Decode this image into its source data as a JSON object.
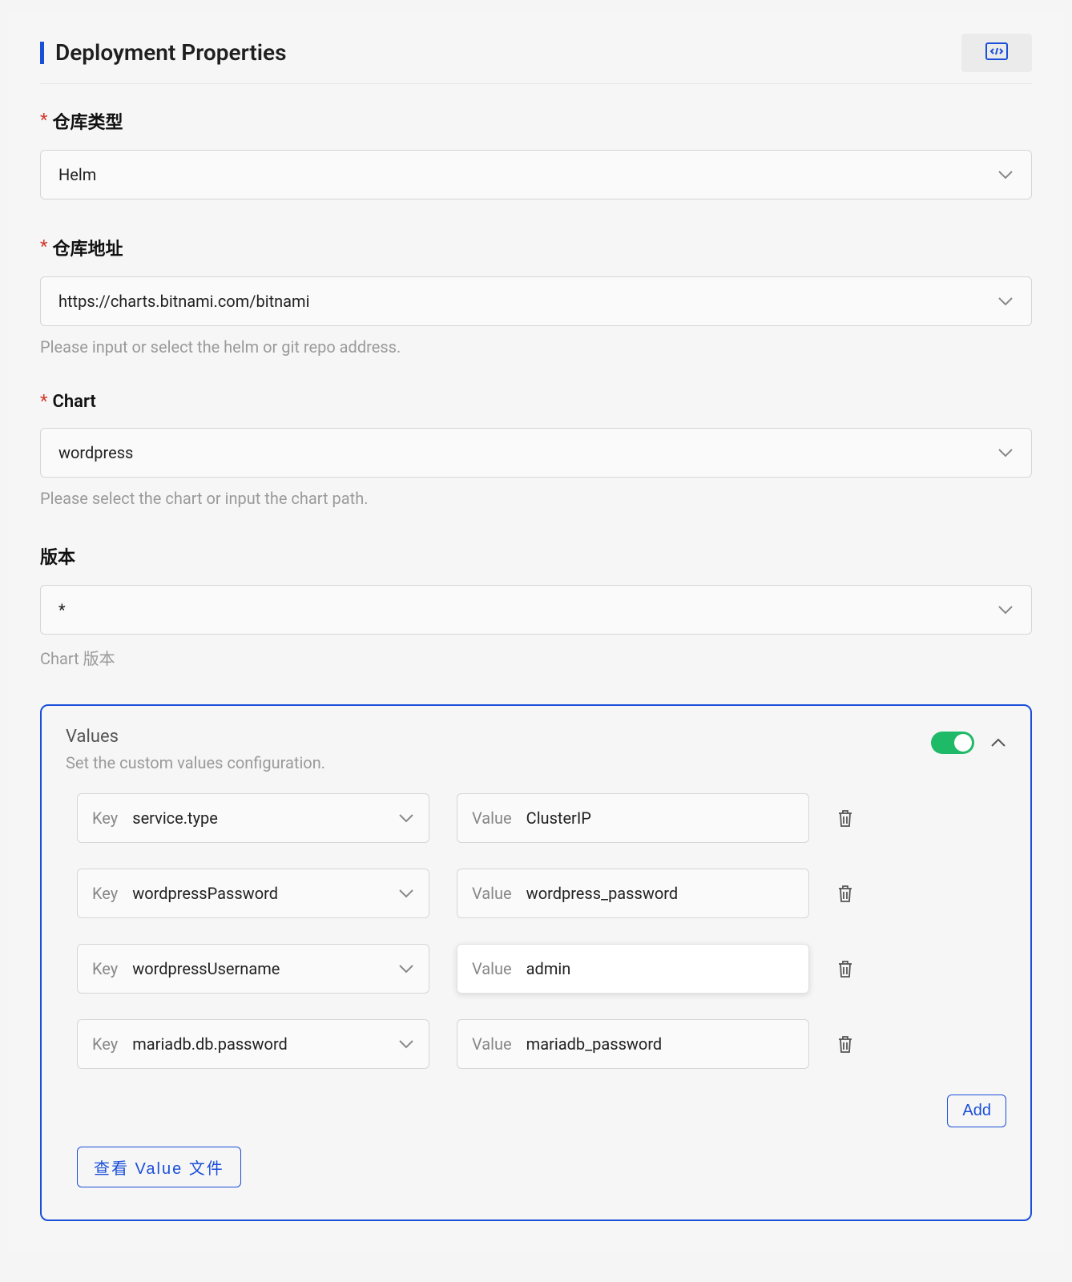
{
  "header": {
    "title": "Deployment Properties"
  },
  "fields": {
    "repo_type": {
      "label": "仓库类型",
      "required": true,
      "value": "Helm"
    },
    "repo_url": {
      "label": "仓库地址",
      "required": true,
      "value": "https://charts.bitnami.com/bitnami",
      "hint": "Please input or select the helm or git repo address."
    },
    "chart": {
      "label": "Chart",
      "required": true,
      "value": "wordpress",
      "hint": "Please select the chart or input the chart path."
    },
    "version": {
      "label": "版本",
      "required": false,
      "value": "*",
      "hint": "Chart 版本"
    }
  },
  "values": {
    "title": "Values",
    "description": "Set the custom values configuration.",
    "enabled": true,
    "key_prefix": "Key",
    "value_prefix": "Value",
    "rows": [
      {
        "key": "service.type",
        "value": "ClusterIP",
        "focused": false
      },
      {
        "key": "wordpressPassword",
        "value": "wordpress_password",
        "focused": false
      },
      {
        "key": "wordpressUsername",
        "value": "admin",
        "focused": true
      },
      {
        "key": "mariadb.db.password",
        "value": "mariadb_password",
        "focused": false
      }
    ],
    "add_label": "Add",
    "view_file_label": "查看 Value 文件"
  }
}
